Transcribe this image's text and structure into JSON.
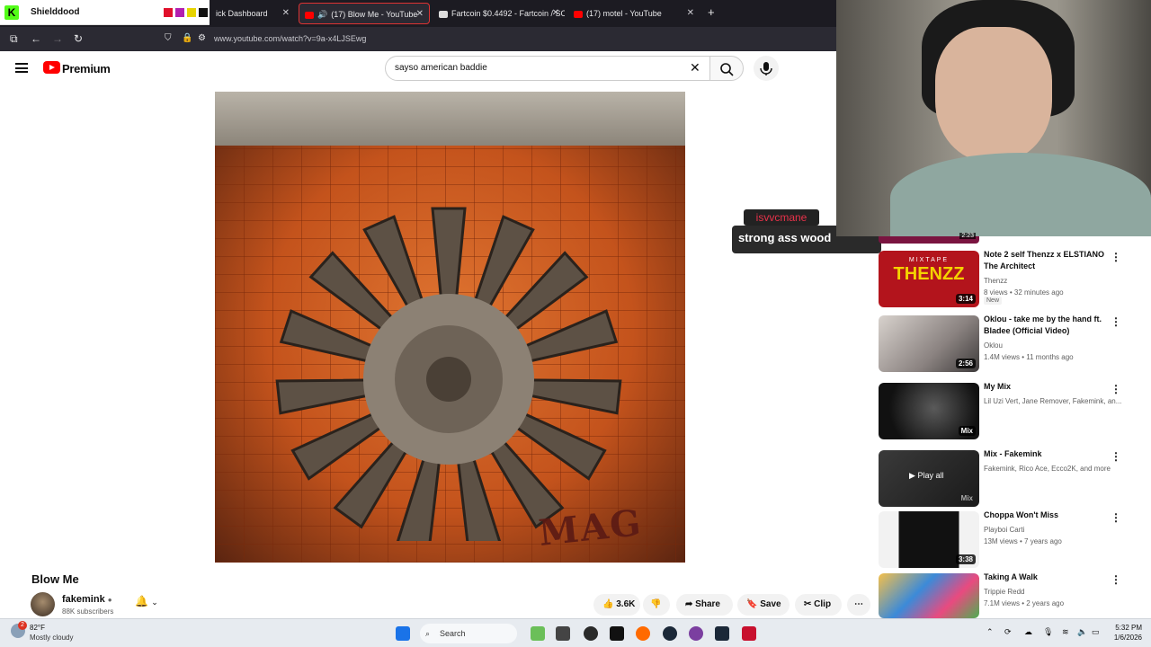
{
  "overlay": {
    "app_name": "Shielddood",
    "swatch_colors": [
      "#e0102b",
      "#b21fb0",
      "#e7d400",
      "#111111"
    ]
  },
  "browser": {
    "tabs": [
      {
        "title": "ick Dashboard"
      },
      {
        "title": "(17) Blow Me - YouTube",
        "active": true
      },
      {
        "title": "Fartcoin $0.4492 - Fartcoin / SO"
      },
      {
        "title": "(17) motel - YouTube"
      }
    ],
    "new_tab": "+",
    "url": "www.youtube.com/watch?v=9a-x4LJSEwg"
  },
  "youtube": {
    "brand": "Premium",
    "search_query": "sayso american baddie",
    "video_watermark": "MAG",
    "video_title": "Blow Me",
    "channel": {
      "name": "fakemink",
      "subscribers": "88K subscribers"
    },
    "actions": {
      "likes": "3.6K",
      "share": "Share",
      "save": "Save",
      "clip": "Clip"
    }
  },
  "chat": {
    "username": "isvvcmane",
    "message": "strong ass wood"
  },
  "sidebar": {
    "partial_duration": "2:23",
    "recommendations": [
      {
        "title": "Note 2 self Thenzz x ELSTIANO The Architect",
        "channel": "Thenzz",
        "meta": "8 views • 32 minutes ago",
        "badge": "New",
        "duration": "3:14",
        "thumb_text": "THENZZ",
        "thumb_label": "MIXTAPE"
      },
      {
        "title": "Oklou - take me by the hand ft. Bladee (Official Video)",
        "channel": "Oklou",
        "meta": "1.4M views • 11 months ago",
        "duration": "2:56"
      },
      {
        "title": "My Mix",
        "channel": "Lil Uzi Vert, Jane Remover, Fakemink, an...",
        "duration": "Mix"
      },
      {
        "title": "Mix - Fakemink",
        "channel": "Fakemink, Rico Ace, Ecco2K, and more",
        "duration": "Mix",
        "overlay": "Play all"
      },
      {
        "title": "Choppa Won't Miss",
        "channel": "Playboi Carti",
        "meta": "13M views • 7 years ago",
        "duration": "3:38"
      },
      {
        "title": "Taking A Walk",
        "channel": "Trippie Redd",
        "meta": "7.1M views • 2 years ago"
      }
    ]
  },
  "taskbar": {
    "weather_temp": "82°F",
    "weather_desc": "Mostly cloudy",
    "weather_badge": "2",
    "search": "Search",
    "time": "5:32 PM",
    "date": "1/6/2026"
  }
}
